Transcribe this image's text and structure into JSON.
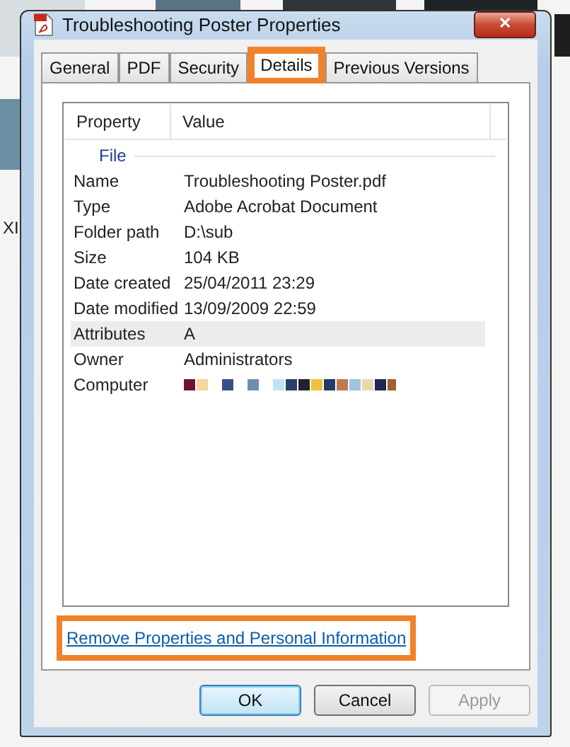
{
  "desktop": {
    "label": "XI"
  },
  "window": {
    "title": "Troubleshooting Poster Properties",
    "close": "✕"
  },
  "tabs": [
    {
      "label": "General",
      "selected": false,
      "annotated": false
    },
    {
      "label": "PDF",
      "selected": false,
      "annotated": false
    },
    {
      "label": "Security",
      "selected": false,
      "annotated": false
    },
    {
      "label": "Details",
      "selected": true,
      "annotated": true
    },
    {
      "label": "Previous Versions",
      "selected": false,
      "annotated": false
    }
  ],
  "table": {
    "columns": [
      "Property",
      "Value"
    ],
    "group": "File",
    "rows": [
      {
        "property": "Name",
        "value": "Troubleshooting Poster.pdf",
        "highlighted": false,
        "kind": "text"
      },
      {
        "property": "Type",
        "value": "Adobe Acrobat Document",
        "highlighted": false,
        "kind": "text"
      },
      {
        "property": "Folder path",
        "value": "D:\\sub",
        "highlighted": false,
        "kind": "text"
      },
      {
        "property": "Size",
        "value": "104 KB",
        "highlighted": false,
        "kind": "text"
      },
      {
        "property": "Date created",
        "value": "25/04/2011 23:29",
        "highlighted": false,
        "kind": "text"
      },
      {
        "property": "Date modified",
        "value": "13/09/2009 22:59",
        "highlighted": false,
        "kind": "text"
      },
      {
        "property": "Attributes",
        "value": "A",
        "highlighted": true,
        "kind": "text"
      },
      {
        "property": "Owner",
        "value": "Administrators",
        "highlighted": false,
        "kind": "text"
      },
      {
        "property": "Computer",
        "highlighted": false,
        "kind": "redacted"
      }
    ]
  },
  "link": {
    "label": "Remove Properties and Personal Information",
    "annotated": true
  },
  "buttons": [
    {
      "label": "OK",
      "default": true,
      "disabled": false
    },
    {
      "label": "Cancel",
      "default": false,
      "disabled": false
    },
    {
      "label": "Apply",
      "default": false,
      "disabled": true
    }
  ]
}
